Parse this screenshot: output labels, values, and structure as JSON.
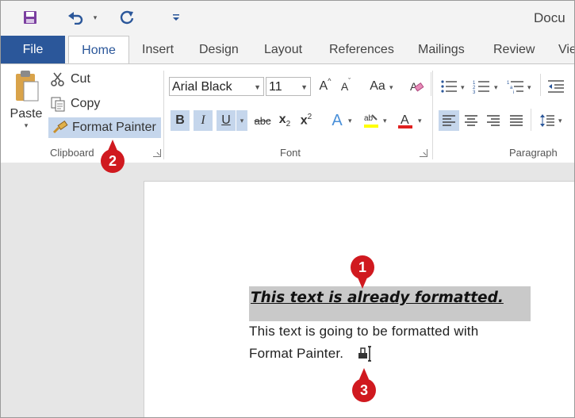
{
  "window": {
    "title": "Docu"
  },
  "qat": {
    "save_icon": "save-icon",
    "undo_icon": "undo-icon",
    "redo_icon": "redo-icon",
    "customize_icon": "customize-qat-icon"
  },
  "tabs": [
    {
      "label": "File"
    },
    {
      "label": "Home"
    },
    {
      "label": "Insert"
    },
    {
      "label": "Design"
    },
    {
      "label": "Layout"
    },
    {
      "label": "References"
    },
    {
      "label": "Mailings"
    },
    {
      "label": "Review"
    },
    {
      "label": "Vie"
    }
  ],
  "clipboard": {
    "paste": "Paste",
    "cut": "Cut",
    "copy": "Copy",
    "format_painter": "Format Painter",
    "group_label": "Clipboard"
  },
  "font": {
    "font_name": "Arial Black",
    "font_size": "11",
    "group_label": "Font",
    "bold": "B",
    "italic": "I",
    "underline": "U",
    "strike": "abc",
    "grow": "A",
    "shrink": "A",
    "change_case": "Aa"
  },
  "paragraph": {
    "group_label": "Paragraph"
  },
  "document": {
    "formatted_text": "This text is already formatted.",
    "line1": "This text is going to be formatted with",
    "line2": "Format Painter."
  },
  "callouts": [
    "1",
    "2",
    "3"
  ],
  "colors": {
    "accent": "#2b579a",
    "callout": "#d0191f",
    "highlight": "#ffff00",
    "font_color": "#e0201f"
  }
}
